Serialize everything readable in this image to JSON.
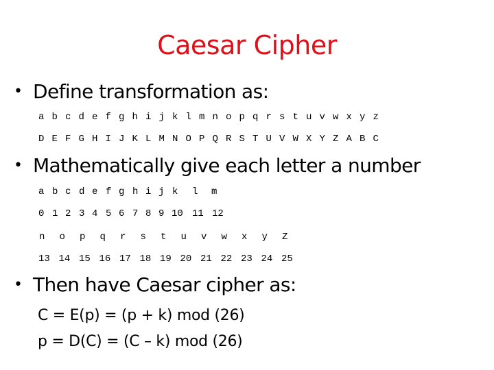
{
  "slide": {
    "title": "Caesar Cipher",
    "title_color": "#e0101a",
    "bullets": [
      "Define transformation as:",
      "Mathematically give each letter a number",
      "Then have Caesar cipher as:"
    ],
    "plain_letters": [
      "a",
      "b",
      "c",
      "d",
      "e",
      "f",
      "g",
      "h",
      "i",
      "j",
      "k",
      "l",
      "m",
      "n",
      "o",
      "p",
      "q",
      "r",
      "s",
      "t",
      "u",
      "v",
      "w",
      "x",
      "y",
      "z"
    ],
    "cipher_letters": [
      "D",
      "E",
      "F",
      "G",
      "H",
      "I",
      "J",
      "K",
      "L",
      "M",
      "N",
      "O",
      "P",
      "Q",
      "R",
      "S",
      "T",
      "U",
      "V",
      "W",
      "X",
      "Y",
      "Z",
      "A",
      "B",
      "C"
    ],
    "number_rows": {
      "letters_a_m": [
        "a",
        "b",
        "c",
        "d",
        "e",
        "f",
        "g",
        "h",
        "i",
        "j",
        "k",
        "l",
        "m"
      ],
      "numbers_0_12": [
        "0",
        "1",
        "2",
        "3",
        "4",
        "5",
        "6",
        "7",
        "8",
        "9",
        "10",
        "11",
        "12"
      ],
      "letters_n_z": [
        "n",
        "o",
        "p",
        "q",
        "r",
        "s",
        "t",
        "u",
        "v",
        "w",
        "x",
        "y",
        "Z"
      ],
      "numbers_13_25": [
        "13",
        "14",
        "15",
        "16",
        "17",
        "18",
        "19",
        "20",
        "21",
        "22",
        "23",
        "24",
        "25"
      ]
    },
    "formulas": {
      "encrypt": "C = E(p) = (p + k) mod (26)",
      "decrypt": "p = D(C) = (C – k) mod (26)"
    }
  }
}
